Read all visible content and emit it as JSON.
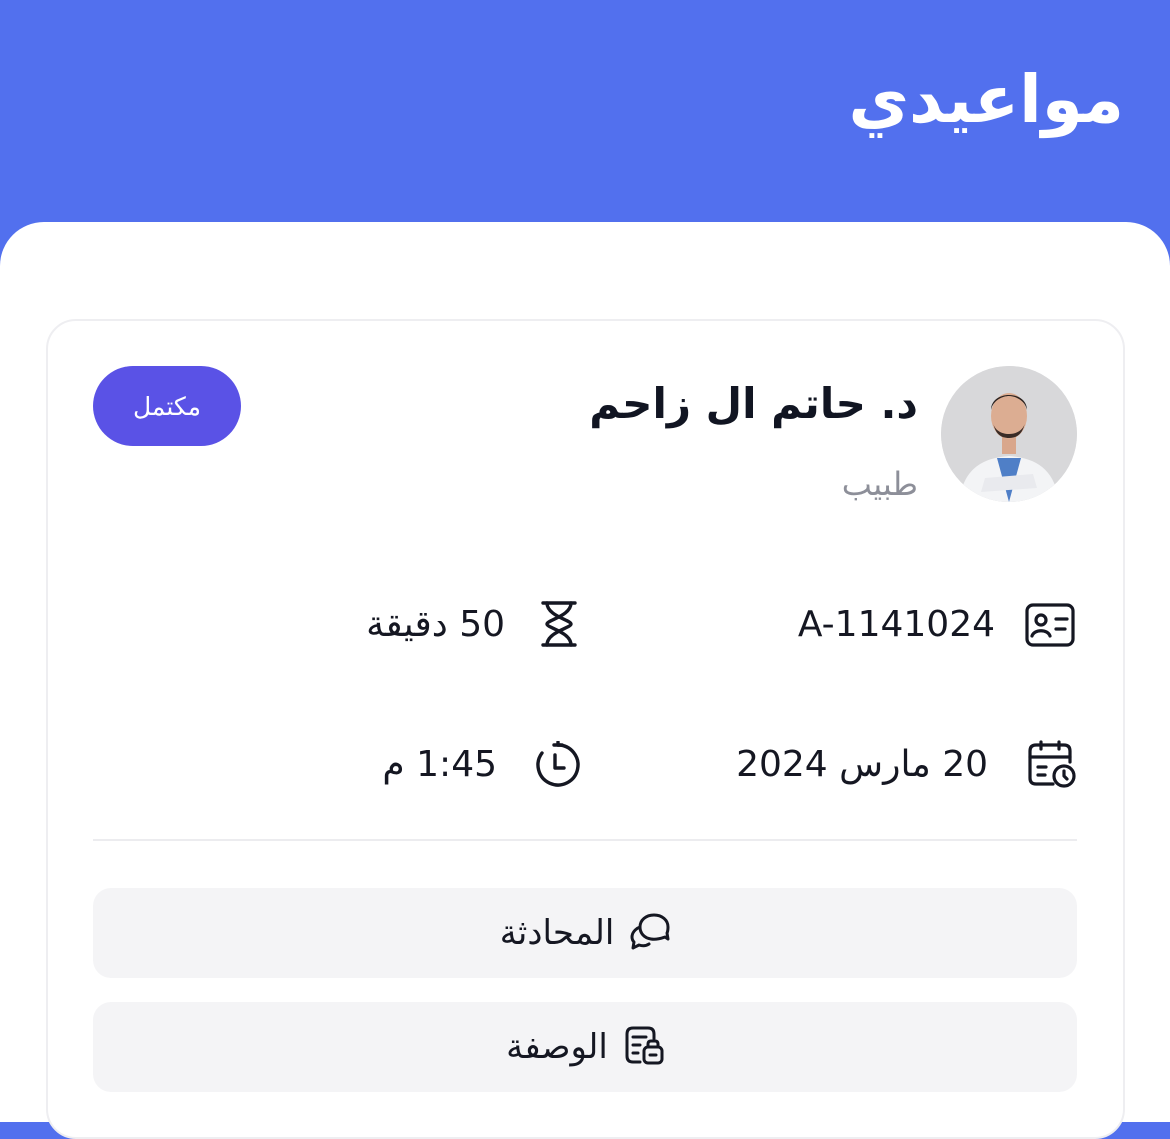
{
  "header": {
    "title": "مواعيدي"
  },
  "appointment": {
    "doctor_name": "د. حاتم ال زاحم",
    "doctor_role": "طبيب",
    "status": "مكتمل",
    "code": "A-1141024",
    "duration": "50 دقيقة",
    "date": "20 مارس 2024",
    "time": "1:45 م"
  },
  "actions": {
    "chat_label": "المحادثة",
    "prescription_label": "الوصفة"
  },
  "colors": {
    "primary": "#5270ee",
    "badge": "#5a52e6",
    "button_bg": "#f4f4f6",
    "text": "#151722",
    "muted": "#8d8f99"
  }
}
